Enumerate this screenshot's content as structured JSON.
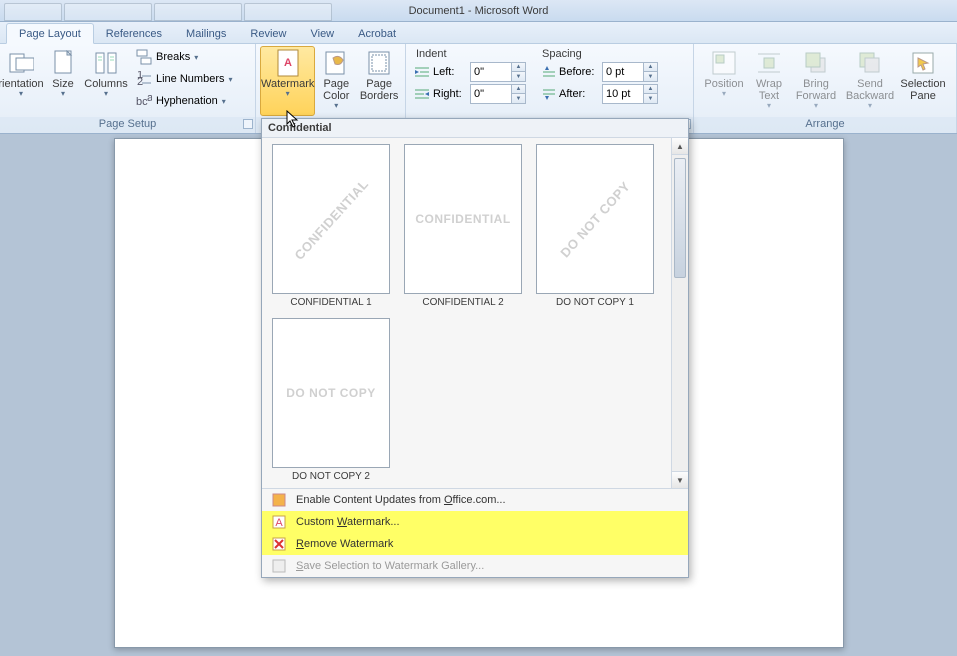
{
  "title": {
    "doc": "Document1",
    "sep": " - ",
    "app": "Microsoft Word"
  },
  "tabs": {
    "page_layout": "Page Layout",
    "references": "References",
    "mailings": "Mailings",
    "review": "Review",
    "view": "View",
    "acrobat": "Acrobat"
  },
  "page_setup": {
    "label": "Page Setup",
    "orientation": "rientation",
    "size": "Size",
    "columns": "Columns",
    "breaks": "Breaks",
    "line_numbers": "Line Numbers",
    "hyphenation": "Hyphenation"
  },
  "page_background": {
    "watermark": "Watermark",
    "page_color": "Page Color",
    "page_borders": "Page Borders"
  },
  "paragraph": {
    "indent_label": "Indent",
    "spacing_label": "Spacing",
    "left_label": "Left:",
    "right_label": "Right:",
    "before_label": "Before:",
    "after_label": "After:",
    "left_val": "0\"",
    "right_val": "0\"",
    "before_val": "0 pt",
    "after_val": "10 pt"
  },
  "arrange": {
    "label": "Arrange",
    "position": "Position",
    "wrap_text": "Wrap Text",
    "bring_forward": "Bring Forward",
    "send_backward": "Send Backward",
    "selection_pane": "Selection Pane"
  },
  "watermark_drop": {
    "header": "Confidential",
    "items": [
      {
        "text": "CONFIDENTIAL",
        "style": "diag",
        "caption": "CONFIDENTIAL 1"
      },
      {
        "text": "CONFIDENTIAL",
        "style": "horiz",
        "caption": "CONFIDENTIAL 2"
      },
      {
        "text": "DO NOT COPY",
        "style": "diag",
        "caption": "DO NOT COPY 1"
      },
      {
        "text": "DO NOT COPY",
        "style": "horiz",
        "caption": "DO NOT COPY 2"
      }
    ],
    "menu": {
      "enable_updates_pre": "Enable Content Updates from ",
      "enable_updates_u": "O",
      "enable_updates_post": "ffice.com...",
      "custom_pre": "Custom ",
      "custom_u": "W",
      "custom_post": "atermark...",
      "remove_u": "R",
      "remove_post": "emove Watermark",
      "save_u": "S",
      "save_post": "ave Selection to Watermark Gallery..."
    }
  }
}
